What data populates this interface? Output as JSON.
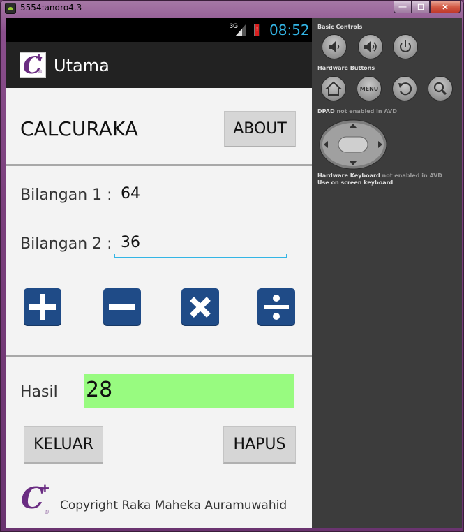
{
  "window": {
    "title": "5554:andro4.3",
    "minimize": "—",
    "maximize": "☐",
    "close": "✕"
  },
  "status_bar": {
    "network": "3G",
    "time": "08:52"
  },
  "action_bar": {
    "title": "Utama"
  },
  "app": {
    "title": "CALCURAKA",
    "about_label": "ABOUT",
    "bilangan1_label": "Bilangan 1 :",
    "bilangan1_value": "64",
    "bilangan2_label": "Bilangan 2 :",
    "bilangan2_value": "36",
    "operators": [
      "+",
      "−",
      "×",
      "÷"
    ],
    "hasil_label": "Hasil",
    "hasil_value": "28",
    "keluar_label": "KELUAR",
    "hapus_label": "HAPUS",
    "copyright": "Copyright Raka Maheka Auramuwahid",
    "logo": {
      "letter": "C",
      "plus": "+",
      "reg": "®"
    }
  },
  "colors": {
    "operator_button": "#1f4b87",
    "result_background": "#98fb80",
    "accent": "#33b5e5"
  },
  "panel": {
    "basic_controls": "Basic Controls",
    "basic_icons": [
      "volume-down-icon",
      "volume-up-icon",
      "power-icon"
    ],
    "hardware_buttons": "Hardware Buttons",
    "menu_label": "MENU",
    "hardware_icons": [
      "home-icon",
      "menu",
      "back-icon",
      "search-icon"
    ],
    "dpad_label": "DPAD",
    "dpad_note": "not enabled in AVD",
    "keyboard_label": "Hardware Keyboard",
    "keyboard_note": "not enabled in AVD",
    "onscreen_keyboard": "Use on screen keyboard"
  }
}
